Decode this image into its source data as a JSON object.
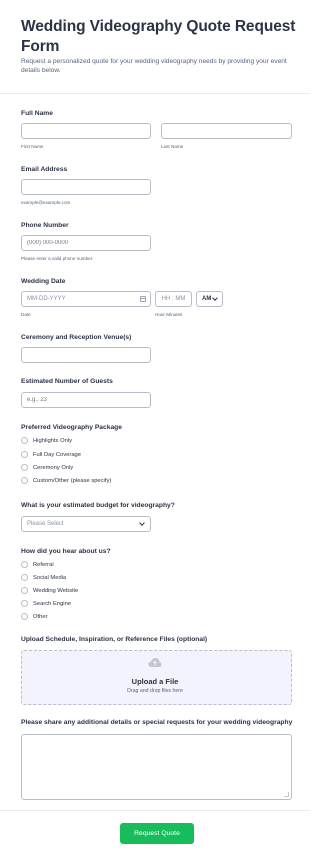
{
  "form": {
    "title": "Wedding Videography Quote Request Form",
    "subtitle": "Request a personalized quote for your wedding videography needs by providing your event details below."
  },
  "full_name": {
    "label": "Full Name",
    "first_sublabel": "First Name",
    "last_sublabel": "Last Name"
  },
  "email": {
    "label": "Email Address",
    "sublabel": "example@example.com"
  },
  "phone": {
    "label": "Phone Number",
    "placeholder": "(000) 000-0000",
    "sublabel": "Please enter a valid phone number."
  },
  "wedding_date": {
    "label": "Wedding Date",
    "date_placeholder": "MM-DD-YYYY",
    "time_placeholder": "HH : MM",
    "ampm_value": "AM",
    "date_sublabel": "Date",
    "time_sublabel": "Hour Minutes"
  },
  "venue": {
    "label": "Ceremony and Reception Venue(s)"
  },
  "guests": {
    "label": "Estimated Number of Guests",
    "placeholder": "e.g., 23"
  },
  "package": {
    "label": "Preferred Videography Package",
    "options": [
      "Highlights Only",
      "Full Day Coverage",
      "Ceremony Only",
      "Custom/Other (please specify)"
    ]
  },
  "budget": {
    "label": "What is your estimated budget for videography?",
    "placeholder": "Please Select"
  },
  "referral": {
    "label": "How did you hear about us?",
    "options": [
      "Referral",
      "Social Media",
      "Wedding Website",
      "Search Engine",
      "Other"
    ]
  },
  "upload": {
    "label": "Upload Schedule, Inspiration, or Reference Files (optional)",
    "title": "Upload a File",
    "subtitle": "Drag and drop files here",
    "icon": "cloud-upload-icon"
  },
  "details": {
    "label": "Please share any additional details or special requests for your wedding videography"
  },
  "submit_label": "Request Quote",
  "colors": {
    "accent": "#18bd5b",
    "text": "#2c3345",
    "border": "#b8bdc9",
    "upload_bg": "#f3f3fe"
  }
}
